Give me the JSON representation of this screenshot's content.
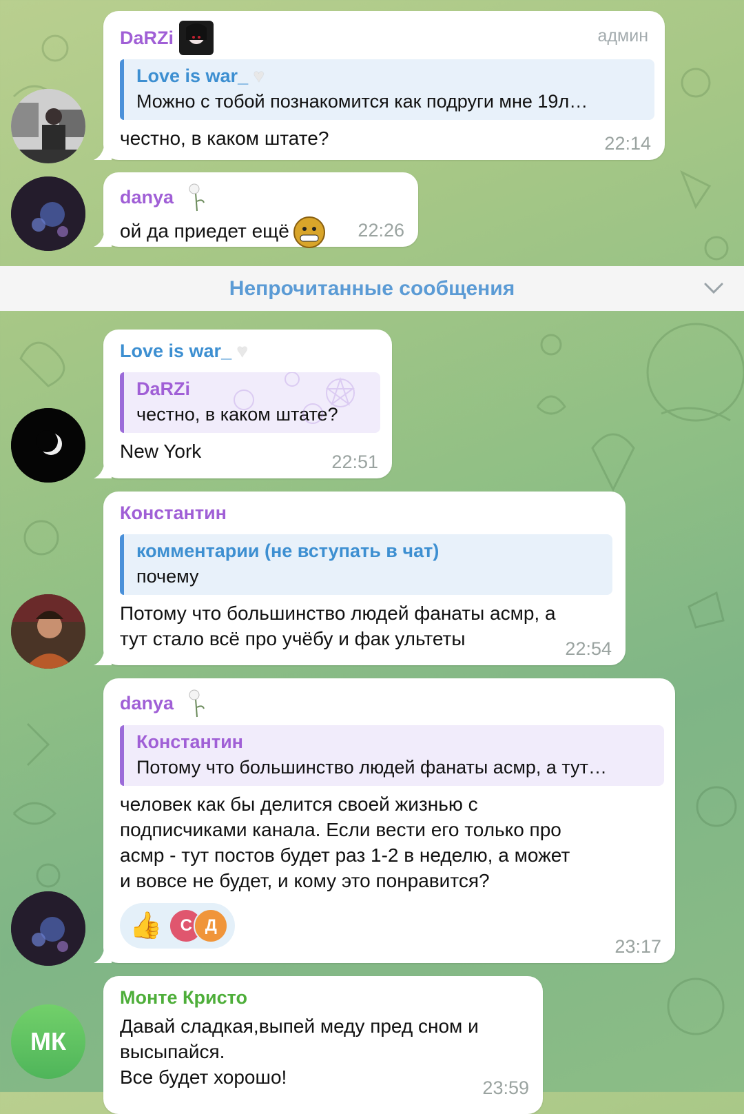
{
  "messages": [
    {
      "sender": "DaRZi",
      "badge": "админ",
      "reply": {
        "name": "Love is war_",
        "text": "Можно с тобой познакомится как подруги мне 19л…"
      },
      "text": "честно, в каком штате?",
      "time": "22:14"
    },
    {
      "sender": "danya",
      "text": "ой да приедет ещё",
      "time": "22:26"
    },
    {
      "sender": "Love is war_",
      "reply": {
        "name": "DaRZi",
        "text": "честно, в каком штате?"
      },
      "text": "New York",
      "time": "22:51"
    },
    {
      "sender": "Константин",
      "reply": {
        "name": "комментарии (не вступать в чат)",
        "text": "почему"
      },
      "text_lines": [
        "Потому что большинство людей фанаты асмр, а",
        "тут стало всё про учёбу и фак ультеты"
      ],
      "time": "22:54"
    },
    {
      "sender": "danya",
      "reply": {
        "name": "Константин",
        "text": "Потому что большинство людей фанаты асмр, а тут…"
      },
      "text_lines": [
        "человек как бы делится своей жизнью с",
        "подписчиками канала. Если вести его только про",
        "асмр - тут постов будет раз 1-2 в неделю, а может",
        "и вовсе не будет, и кому это понравится?"
      ],
      "reactions": {
        "emoji": "👍",
        "users": [
          "С",
          "Д"
        ]
      },
      "time": "23:17"
    },
    {
      "sender": "Монте Кристо",
      "avatar_initials": "МК",
      "text_lines": [
        "Давай сладкая,выпей меду пред сном и",
        "высыпайся.",
        "Все будет хорошо!"
      ],
      "time": "23:59"
    }
  ],
  "unread_label": "Непрочитанные сообщения",
  "colors": {
    "name_purple": "#a05fd6",
    "name_blue": "#3d8fd1",
    "name_green": "#4eae3a",
    "accent": "#5b9bd5",
    "time_gray": "#9aa3a0"
  }
}
